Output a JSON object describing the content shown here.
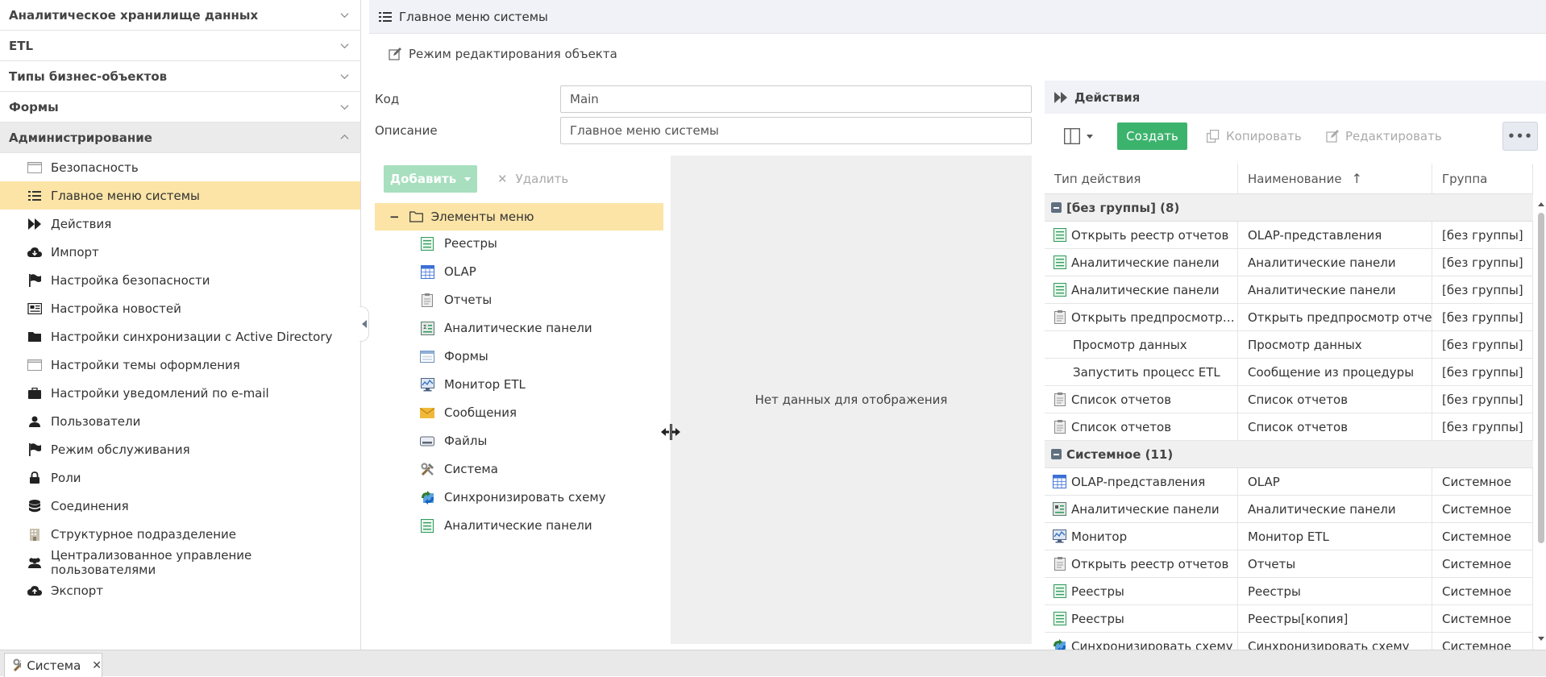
{
  "sidebar": {
    "sections": [
      {
        "label": "Аналитическое хранилище данных"
      },
      {
        "label": "ETL"
      },
      {
        "label": "Типы бизнес-объектов"
      },
      {
        "label": "Формы"
      },
      {
        "label": "Администрирование"
      }
    ],
    "items": [
      {
        "label": "Безопасность",
        "icon": "window-icon"
      },
      {
        "label": "Главное меню системы",
        "icon": "list-icon"
      },
      {
        "label": "Действия",
        "icon": "fast-forward-icon"
      },
      {
        "label": "Импорт",
        "icon": "cloud-download-icon"
      },
      {
        "label": "Настройка безопасности",
        "icon": "flag-icon"
      },
      {
        "label": "Настройка новостей",
        "icon": "newspaper-icon"
      },
      {
        "label": "Настройки синхронизации с Active Directory",
        "icon": "folder-icon"
      },
      {
        "label": "Настройки темы оформления",
        "icon": "window-icon"
      },
      {
        "label": "Настройки уведомлений по e-mail",
        "icon": "briefcase-icon"
      },
      {
        "label": "Пользователи",
        "icon": "user-icon"
      },
      {
        "label": "Режим обслуживания",
        "icon": "flag-icon"
      },
      {
        "label": "Роли",
        "icon": "lock-icon"
      },
      {
        "label": "Соединения",
        "icon": "database-icon"
      },
      {
        "label": "Структурное подразделение",
        "icon": "building-icon"
      },
      {
        "label": "Централизованное управление пользователями",
        "icon": "users-icon"
      },
      {
        "label": "Экспорт",
        "icon": "cloud-upload-icon"
      }
    ]
  },
  "header": {
    "title": "Главное меню системы"
  },
  "form": {
    "edit_mode_label": "Режим редактирования объекта",
    "code_label": "Код",
    "code_value": "Main",
    "desc_label": "Описание",
    "desc_value": "Главное меню системы"
  },
  "tree": {
    "add_label": "Добавить",
    "delete_label": "Удалить",
    "root_label": "Элементы меню",
    "items": [
      {
        "label": "Реестры",
        "icon": "registry-icon"
      },
      {
        "label": "OLAP",
        "icon": "olap-icon"
      },
      {
        "label": "Отчеты",
        "icon": "clipboard-icon"
      },
      {
        "label": "Аналитические панели",
        "icon": "dashboard-icon"
      },
      {
        "label": "Формы",
        "icon": "form-icon"
      },
      {
        "label": "Монитор ETL",
        "icon": "monitor-icon"
      },
      {
        "label": "Сообщения",
        "icon": "envelope-icon"
      },
      {
        "label": "Файлы",
        "icon": "drive-icon"
      },
      {
        "label": "Система",
        "icon": "tools-icon"
      },
      {
        "label": "Синхронизировать схему",
        "icon": "sync-icon"
      },
      {
        "label": "Аналитические панели",
        "icon": "registry-icon"
      }
    ],
    "empty_text": "Нет данных для отображения"
  },
  "actions": {
    "title": "Действия",
    "create_label": "Создать",
    "copy_label": "Копировать",
    "edit_label": "Редактировать",
    "more_label": "•••",
    "columns": [
      "Тип действия",
      "Наименование",
      "Группа"
    ],
    "groups": [
      {
        "label": "[без группы] (8)",
        "rows": [
          {
            "type": "Открыть реестр отчетов",
            "name": "OLAP-представления",
            "group": "[без группы]",
            "icon": "registry-icon"
          },
          {
            "type": "Аналитические панели",
            "name": "Аналитические панели",
            "group": "[без группы]",
            "icon": "registry-icon"
          },
          {
            "type": "Аналитические панели",
            "name": "Аналитические панели",
            "group": "[без группы]",
            "icon": "registry-icon"
          },
          {
            "type": "Открыть предпросмотр о...",
            "name": "Открыть предпросмотр отчета",
            "group": "[без группы]",
            "icon": "clipboard-icon"
          },
          {
            "type": "Просмотр данных",
            "name": "Просмотр данных",
            "group": "[без группы]",
            "icon": ""
          },
          {
            "type": "Запустить процесс ETL",
            "name": "Сообщение из процедуры",
            "group": "[без группы]",
            "icon": ""
          },
          {
            "type": "Список отчетов",
            "name": "Список отчетов",
            "group": "[без группы]",
            "icon": "clipboard-icon"
          },
          {
            "type": "Список отчетов",
            "name": "Список отчетов",
            "group": "[без группы]",
            "icon": "clipboard-icon"
          }
        ]
      },
      {
        "label": "Системное (11)",
        "rows": [
          {
            "type": "OLAP-представления",
            "name": "OLAP",
            "group": "Системное",
            "icon": "olap-icon"
          },
          {
            "type": "Аналитические панели",
            "name": "Аналитические панели",
            "group": "Системное",
            "icon": "dashboard-icon"
          },
          {
            "type": "Монитор",
            "name": "Монитор ETL",
            "group": "Системное",
            "icon": "monitor-icon"
          },
          {
            "type": "Открыть реестр отчетов",
            "name": "Отчеты",
            "group": "Системное",
            "icon": "clipboard-icon"
          },
          {
            "type": "Реестры",
            "name": "Реестры",
            "group": "Системное",
            "icon": "registry-icon"
          },
          {
            "type": "Реестры",
            "name": "Реестры[копия]",
            "group": "Системное",
            "icon": "registry-icon"
          },
          {
            "type": "Синхронизировать схему",
            "name": "Синхронизировать схему",
            "group": "Системное",
            "icon": "sync-icon"
          }
        ]
      }
    ]
  },
  "bottom_tabs": [
    {
      "label": "Система"
    }
  ],
  "colors": {
    "selected": "#fbe4a6",
    "primary_green": "#3cb36d",
    "disabled_green": "#a7dfbf",
    "header_bg": "#f0f2f7"
  }
}
